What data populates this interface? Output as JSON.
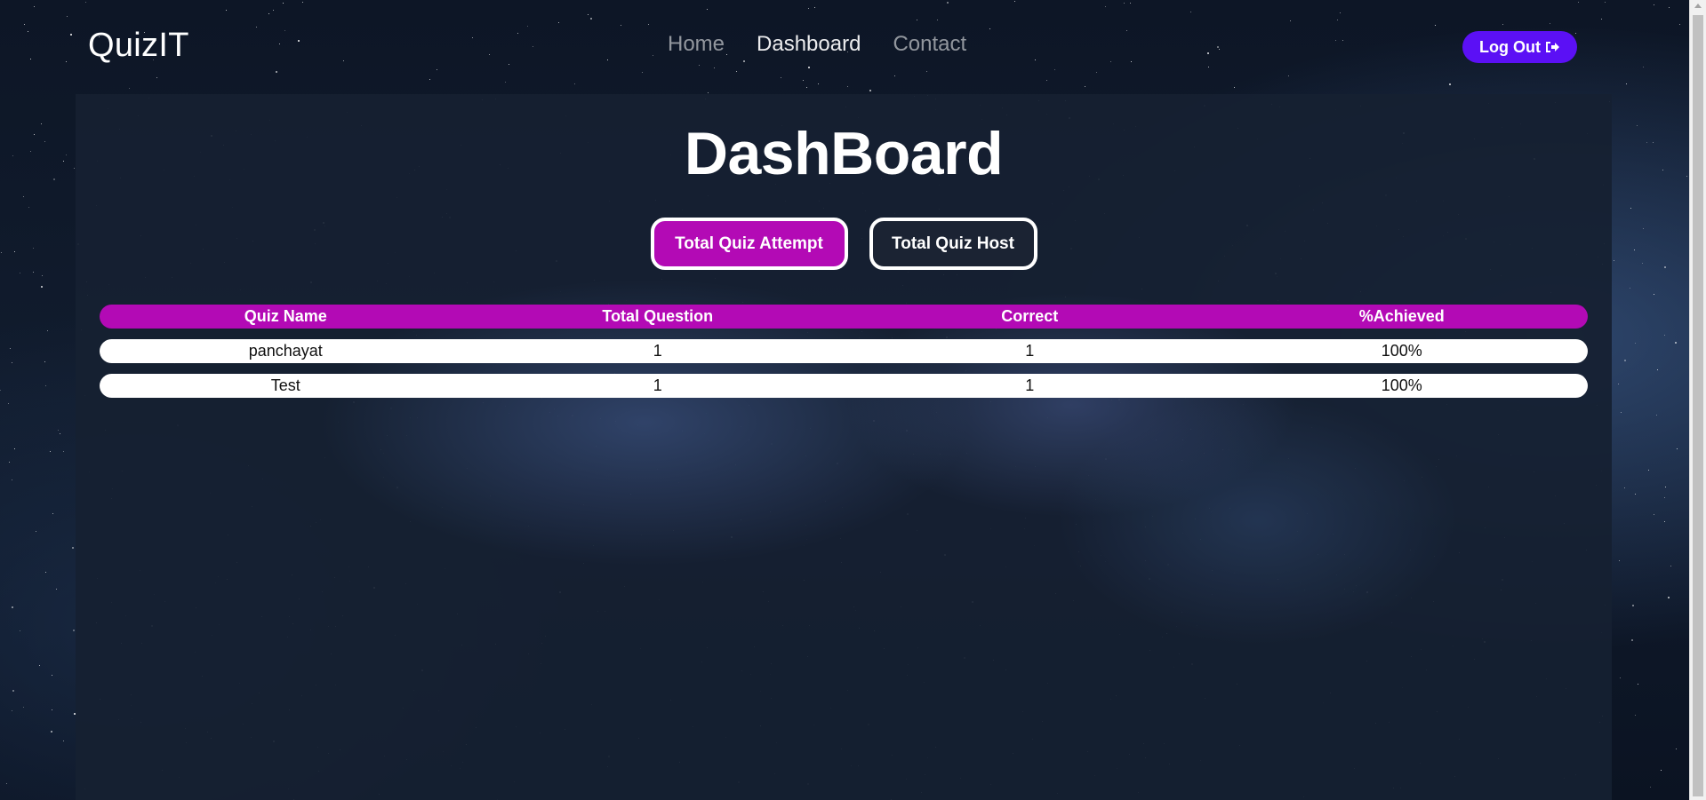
{
  "header": {
    "brand": "QuizIT",
    "nav": [
      {
        "label": "Home",
        "active": false
      },
      {
        "label": "Dashboard",
        "active": true
      },
      {
        "label": "Contact",
        "active": false
      }
    ],
    "logout_label": "Log Out",
    "logout_icon": "sign-out-icon",
    "logout_color": "#5b10f5"
  },
  "main": {
    "title": "DashBoard",
    "tabs": {
      "attempt_label": "Total Quiz Attempt",
      "host_label": "Total Quiz Host"
    },
    "table": {
      "headers": [
        "Quiz Name",
        "Total Question",
        "Correct",
        "%Achieved"
      ],
      "rows": [
        [
          "panchayat",
          "1",
          "1",
          "100%"
        ],
        [
          "Test",
          "1",
          "1",
          "100%"
        ]
      ]
    },
    "accent_color": "#b30ab5"
  }
}
